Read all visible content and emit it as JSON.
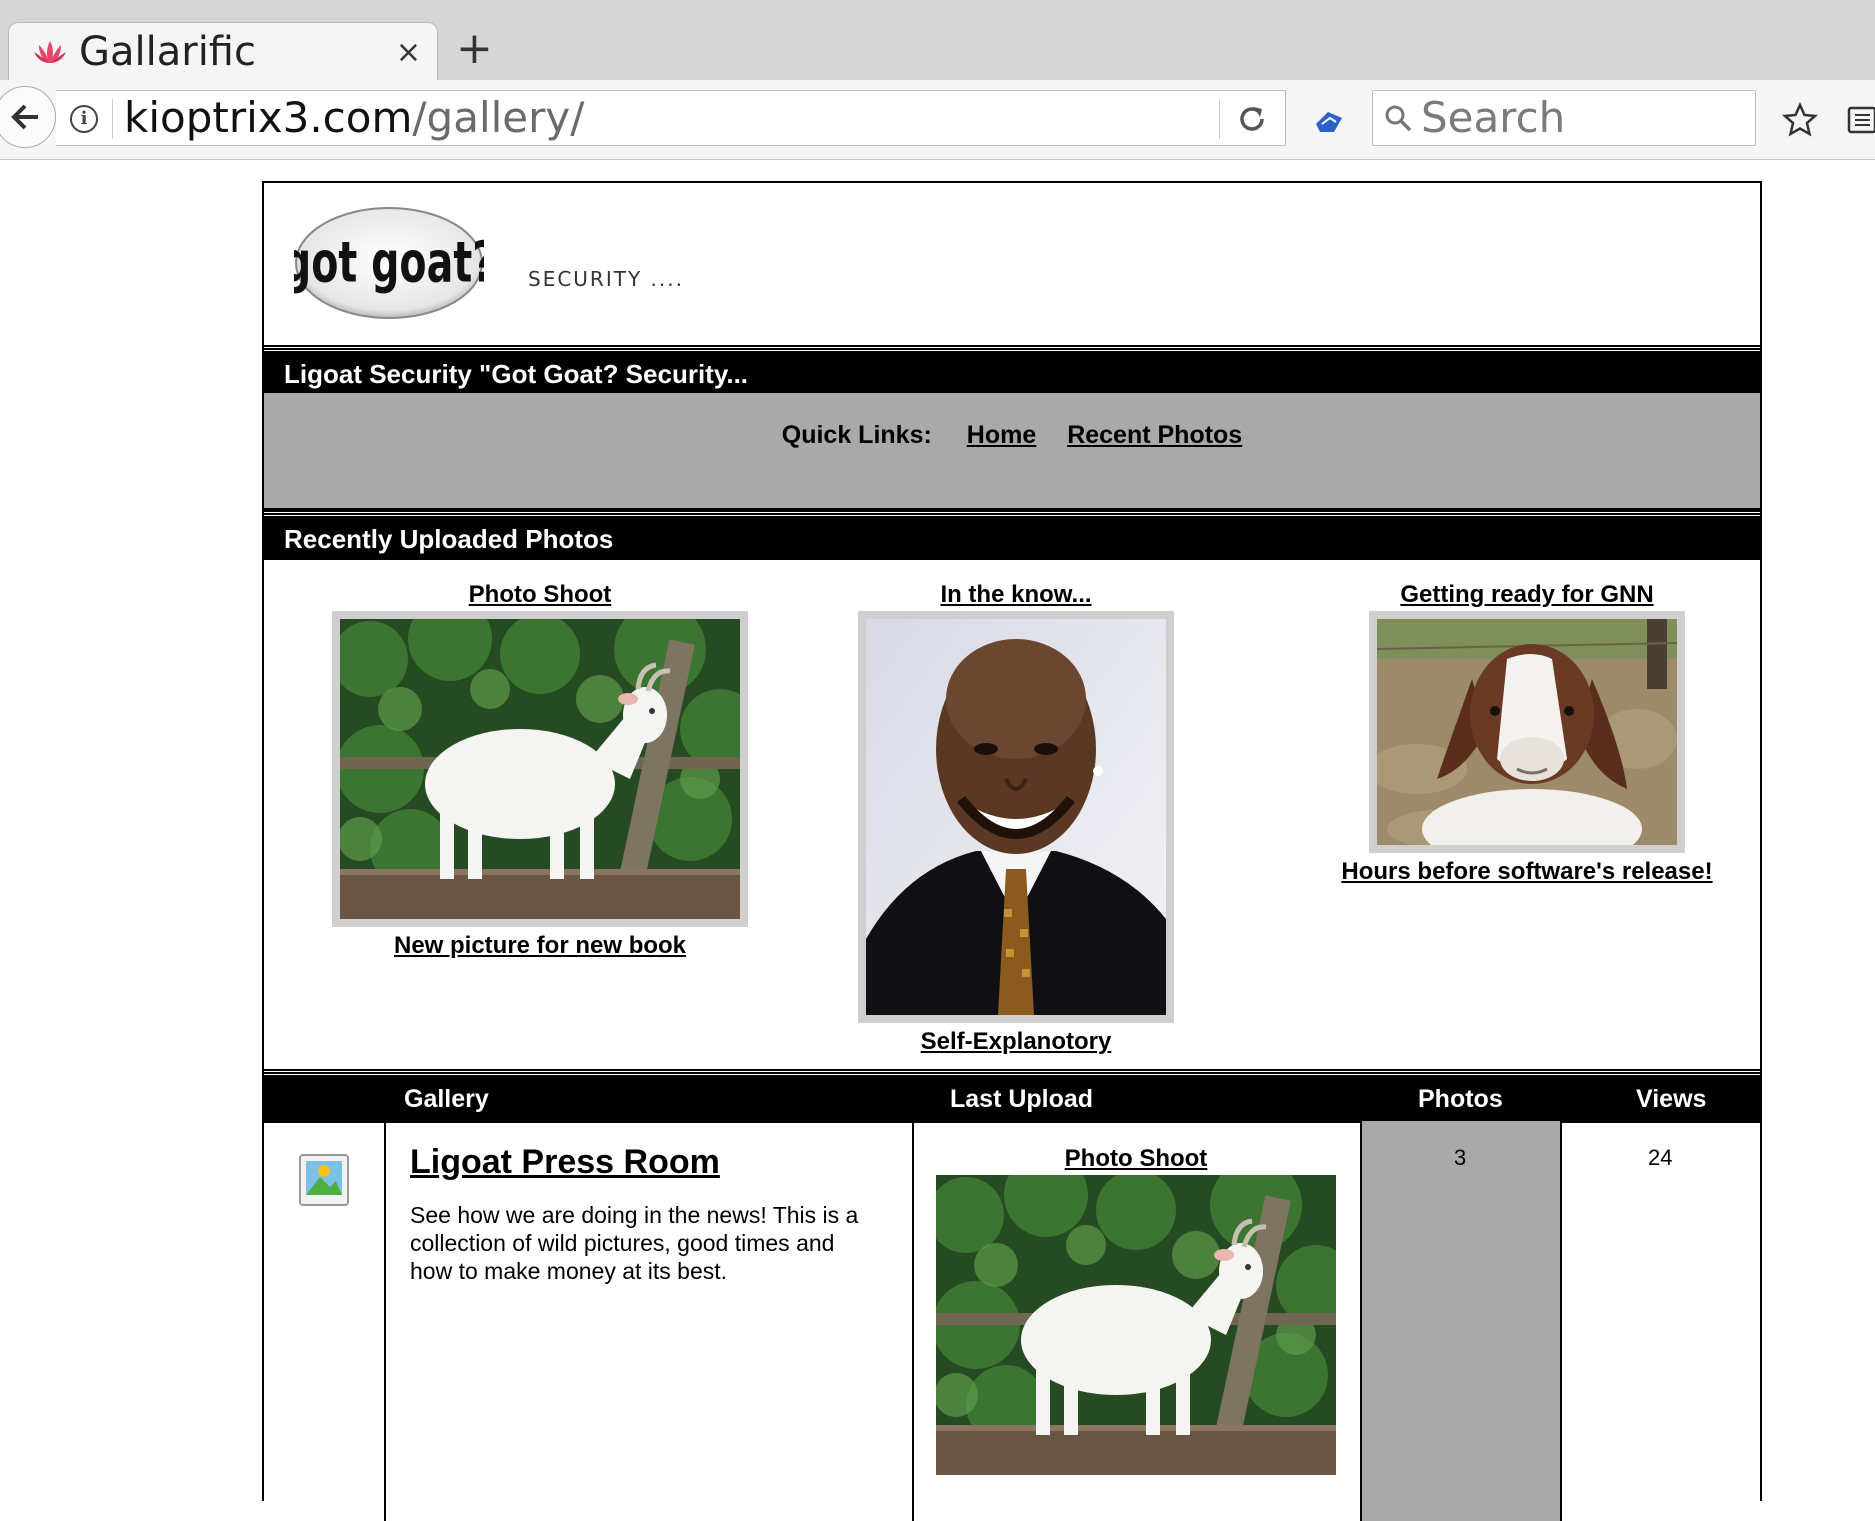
{
  "browser": {
    "tab_title": "Gallarific",
    "tab_close": "×",
    "new_tab": "+",
    "url_host": "kioptrix3.com",
    "url_path": "/gallery/",
    "search_placeholder": "Search"
  },
  "header": {
    "logo_text": "got goat?",
    "tagline": "SECURITY ...."
  },
  "site_bar": {
    "title": "Ligoat Security \"Got Goat? Security..."
  },
  "quick_links": {
    "label": "Quick Links:",
    "items": [
      "Home",
      "Recent Photos"
    ]
  },
  "recent": {
    "heading": "Recently Uploaded Photos",
    "photos": [
      {
        "title": "Photo Shoot",
        "caption": "New picture for new book"
      },
      {
        "title": "In the know...",
        "caption": "Self-Explanotory"
      },
      {
        "title": "Getting ready for GNN",
        "caption": "Hours before software's release!"
      }
    ]
  },
  "gallery_table": {
    "columns": [
      "Gallery",
      "Last Upload",
      "Photos",
      "Views"
    ],
    "rows": [
      {
        "name": "Ligoat Press Room",
        "description": "See how we are doing in the news! This is a collection of wild pictures, good times and how to make money at its best.",
        "last_upload_title": "Photo Shoot",
        "photos": "3",
        "views": "24"
      }
    ]
  },
  "colors": {
    "header_bg": "#000000",
    "quicklinks_bg": "#a9a9a9",
    "thumb_frame": "#cfcfcf"
  }
}
